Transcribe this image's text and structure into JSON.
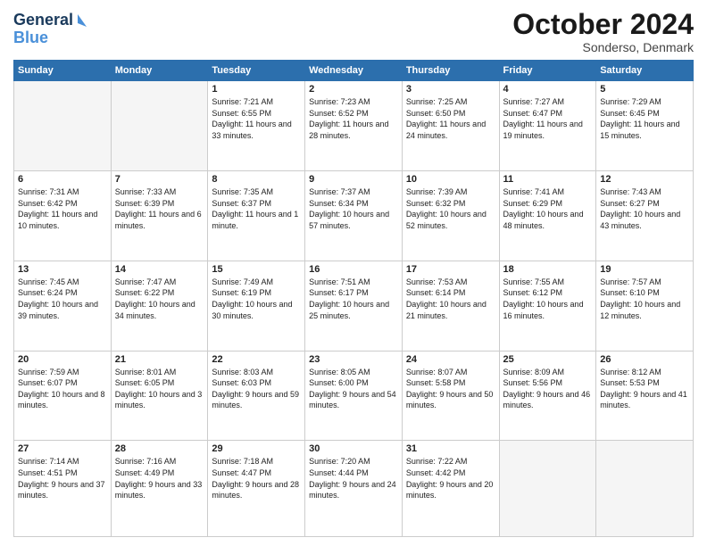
{
  "header": {
    "logo_line1": "General",
    "logo_line2": "Blue",
    "month": "October 2024",
    "location": "Sonderso, Denmark"
  },
  "weekdays": [
    "Sunday",
    "Monday",
    "Tuesday",
    "Wednesday",
    "Thursday",
    "Friday",
    "Saturday"
  ],
  "weeks": [
    [
      {
        "day": "",
        "sunrise": "",
        "sunset": "",
        "daylight": ""
      },
      {
        "day": "",
        "sunrise": "",
        "sunset": "",
        "daylight": ""
      },
      {
        "day": "1",
        "sunrise": "Sunrise: 7:21 AM",
        "sunset": "Sunset: 6:55 PM",
        "daylight": "Daylight: 11 hours and 33 minutes."
      },
      {
        "day": "2",
        "sunrise": "Sunrise: 7:23 AM",
        "sunset": "Sunset: 6:52 PM",
        "daylight": "Daylight: 11 hours and 28 minutes."
      },
      {
        "day": "3",
        "sunrise": "Sunrise: 7:25 AM",
        "sunset": "Sunset: 6:50 PM",
        "daylight": "Daylight: 11 hours and 24 minutes."
      },
      {
        "day": "4",
        "sunrise": "Sunrise: 7:27 AM",
        "sunset": "Sunset: 6:47 PM",
        "daylight": "Daylight: 11 hours and 19 minutes."
      },
      {
        "day": "5",
        "sunrise": "Sunrise: 7:29 AM",
        "sunset": "Sunset: 6:45 PM",
        "daylight": "Daylight: 11 hours and 15 minutes."
      }
    ],
    [
      {
        "day": "6",
        "sunrise": "Sunrise: 7:31 AM",
        "sunset": "Sunset: 6:42 PM",
        "daylight": "Daylight: 11 hours and 10 minutes."
      },
      {
        "day": "7",
        "sunrise": "Sunrise: 7:33 AM",
        "sunset": "Sunset: 6:39 PM",
        "daylight": "Daylight: 11 hours and 6 minutes."
      },
      {
        "day": "8",
        "sunrise": "Sunrise: 7:35 AM",
        "sunset": "Sunset: 6:37 PM",
        "daylight": "Daylight: 11 hours and 1 minute."
      },
      {
        "day": "9",
        "sunrise": "Sunrise: 7:37 AM",
        "sunset": "Sunset: 6:34 PM",
        "daylight": "Daylight: 10 hours and 57 minutes."
      },
      {
        "day": "10",
        "sunrise": "Sunrise: 7:39 AM",
        "sunset": "Sunset: 6:32 PM",
        "daylight": "Daylight: 10 hours and 52 minutes."
      },
      {
        "day": "11",
        "sunrise": "Sunrise: 7:41 AM",
        "sunset": "Sunset: 6:29 PM",
        "daylight": "Daylight: 10 hours and 48 minutes."
      },
      {
        "day": "12",
        "sunrise": "Sunrise: 7:43 AM",
        "sunset": "Sunset: 6:27 PM",
        "daylight": "Daylight: 10 hours and 43 minutes."
      }
    ],
    [
      {
        "day": "13",
        "sunrise": "Sunrise: 7:45 AM",
        "sunset": "Sunset: 6:24 PM",
        "daylight": "Daylight: 10 hours and 39 minutes."
      },
      {
        "day": "14",
        "sunrise": "Sunrise: 7:47 AM",
        "sunset": "Sunset: 6:22 PM",
        "daylight": "Daylight: 10 hours and 34 minutes."
      },
      {
        "day": "15",
        "sunrise": "Sunrise: 7:49 AM",
        "sunset": "Sunset: 6:19 PM",
        "daylight": "Daylight: 10 hours and 30 minutes."
      },
      {
        "day": "16",
        "sunrise": "Sunrise: 7:51 AM",
        "sunset": "Sunset: 6:17 PM",
        "daylight": "Daylight: 10 hours and 25 minutes."
      },
      {
        "day": "17",
        "sunrise": "Sunrise: 7:53 AM",
        "sunset": "Sunset: 6:14 PM",
        "daylight": "Daylight: 10 hours and 21 minutes."
      },
      {
        "day": "18",
        "sunrise": "Sunrise: 7:55 AM",
        "sunset": "Sunset: 6:12 PM",
        "daylight": "Daylight: 10 hours and 16 minutes."
      },
      {
        "day": "19",
        "sunrise": "Sunrise: 7:57 AM",
        "sunset": "Sunset: 6:10 PM",
        "daylight": "Daylight: 10 hours and 12 minutes."
      }
    ],
    [
      {
        "day": "20",
        "sunrise": "Sunrise: 7:59 AM",
        "sunset": "Sunset: 6:07 PM",
        "daylight": "Daylight: 10 hours and 8 minutes."
      },
      {
        "day": "21",
        "sunrise": "Sunrise: 8:01 AM",
        "sunset": "Sunset: 6:05 PM",
        "daylight": "Daylight: 10 hours and 3 minutes."
      },
      {
        "day": "22",
        "sunrise": "Sunrise: 8:03 AM",
        "sunset": "Sunset: 6:03 PM",
        "daylight": "Daylight: 9 hours and 59 minutes."
      },
      {
        "day": "23",
        "sunrise": "Sunrise: 8:05 AM",
        "sunset": "Sunset: 6:00 PM",
        "daylight": "Daylight: 9 hours and 54 minutes."
      },
      {
        "day": "24",
        "sunrise": "Sunrise: 8:07 AM",
        "sunset": "Sunset: 5:58 PM",
        "daylight": "Daylight: 9 hours and 50 minutes."
      },
      {
        "day": "25",
        "sunrise": "Sunrise: 8:09 AM",
        "sunset": "Sunset: 5:56 PM",
        "daylight": "Daylight: 9 hours and 46 minutes."
      },
      {
        "day": "26",
        "sunrise": "Sunrise: 8:12 AM",
        "sunset": "Sunset: 5:53 PM",
        "daylight": "Daylight: 9 hours and 41 minutes."
      }
    ],
    [
      {
        "day": "27",
        "sunrise": "Sunrise: 7:14 AM",
        "sunset": "Sunset: 4:51 PM",
        "daylight": "Daylight: 9 hours and 37 minutes."
      },
      {
        "day": "28",
        "sunrise": "Sunrise: 7:16 AM",
        "sunset": "Sunset: 4:49 PM",
        "daylight": "Daylight: 9 hours and 33 minutes."
      },
      {
        "day": "29",
        "sunrise": "Sunrise: 7:18 AM",
        "sunset": "Sunset: 4:47 PM",
        "daylight": "Daylight: 9 hours and 28 minutes."
      },
      {
        "day": "30",
        "sunrise": "Sunrise: 7:20 AM",
        "sunset": "Sunset: 4:44 PM",
        "daylight": "Daylight: 9 hours and 24 minutes."
      },
      {
        "day": "31",
        "sunrise": "Sunrise: 7:22 AM",
        "sunset": "Sunset: 4:42 PM",
        "daylight": "Daylight: 9 hours and 20 minutes."
      },
      {
        "day": "",
        "sunrise": "",
        "sunset": "",
        "daylight": ""
      },
      {
        "day": "",
        "sunrise": "",
        "sunset": "",
        "daylight": ""
      }
    ]
  ]
}
